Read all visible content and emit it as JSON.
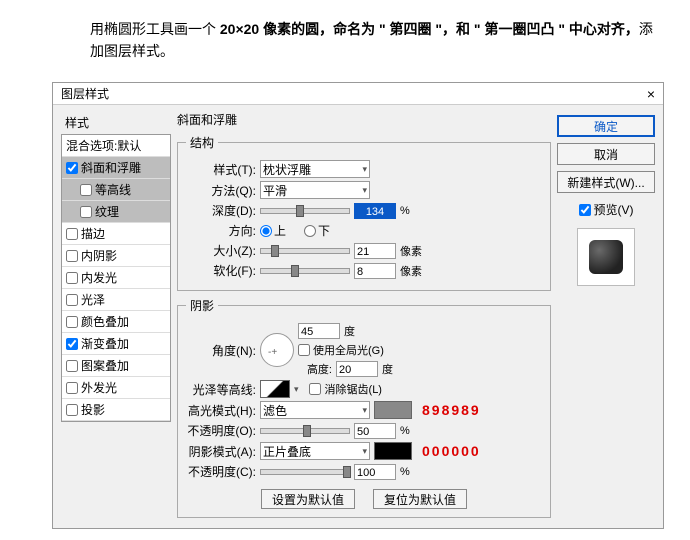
{
  "intro": {
    "prefix": "用椭圆形工具画一个 ",
    "bold1": "20×20 像素的圆，命名为 \" 第四圈 \"，和 \" 第一圈凹凸 \" 中心对齐，",
    "suffix": "添加图层样式。"
  },
  "dialog": {
    "title": "图层样式",
    "close": "×"
  },
  "left": {
    "heading": "样式",
    "items": [
      {
        "label": "混合选项:默认",
        "checked": null
      },
      {
        "label": "斜面和浮雕",
        "checked": true,
        "selected": true
      },
      {
        "label": "等高线",
        "checked": false,
        "sub": true,
        "selected": true
      },
      {
        "label": "纹理",
        "checked": false,
        "sub": true,
        "selected": true
      },
      {
        "label": "描边",
        "checked": false
      },
      {
        "label": "内阴影",
        "checked": false
      },
      {
        "label": "内发光",
        "checked": false
      },
      {
        "label": "光泽",
        "checked": false
      },
      {
        "label": "颜色叠加",
        "checked": false
      },
      {
        "label": "渐变叠加",
        "checked": true
      },
      {
        "label": "图案叠加",
        "checked": false
      },
      {
        "label": "外发光",
        "checked": false
      },
      {
        "label": "投影",
        "checked": false
      }
    ]
  },
  "structure": {
    "legend": "结构",
    "title": "斜面和浮雕",
    "style_lbl": "样式(T):",
    "style_val": "枕状浮雕",
    "method_lbl": "方法(Q):",
    "method_val": "平滑",
    "depth_lbl": "深度(D):",
    "depth_val": "134",
    "depth_unit": "%",
    "dir_lbl": "方向:",
    "dir_up": "上",
    "dir_down": "下",
    "size_lbl": "大小(Z):",
    "size_val": "21",
    "size_unit": "像素",
    "soften_lbl": "软化(F):",
    "soften_val": "8",
    "soften_unit": "像素"
  },
  "shadow": {
    "legend": "阴影",
    "angle_lbl": "角度(N):",
    "angle_val": "45",
    "angle_unit": "度",
    "global_lbl": "使用全局光(G)",
    "alt_lbl": "高度:",
    "alt_val": "20",
    "alt_unit": "度",
    "gloss_lbl": "光泽等高线:",
    "anti_lbl": "消除锯齿(L)",
    "hmode_lbl": "高光模式(H):",
    "hmode_val": "滤色",
    "hmode_hex": "898989",
    "hop_lbl": "不透明度(O):",
    "hop_val": "50",
    "hop_unit": "%",
    "smode_lbl": "阴影模式(A):",
    "smode_val": "正片叠底",
    "smode_hex": "000000",
    "sop_lbl": "不透明度(C):",
    "sop_val": "100",
    "sop_unit": "%"
  },
  "buttons": {
    "default": "设置为默认值",
    "reset": "复位为默认值"
  },
  "right": {
    "ok": "确定",
    "cancel": "取消",
    "newstyle": "新建样式(W)...",
    "preview": "预览(V)"
  }
}
